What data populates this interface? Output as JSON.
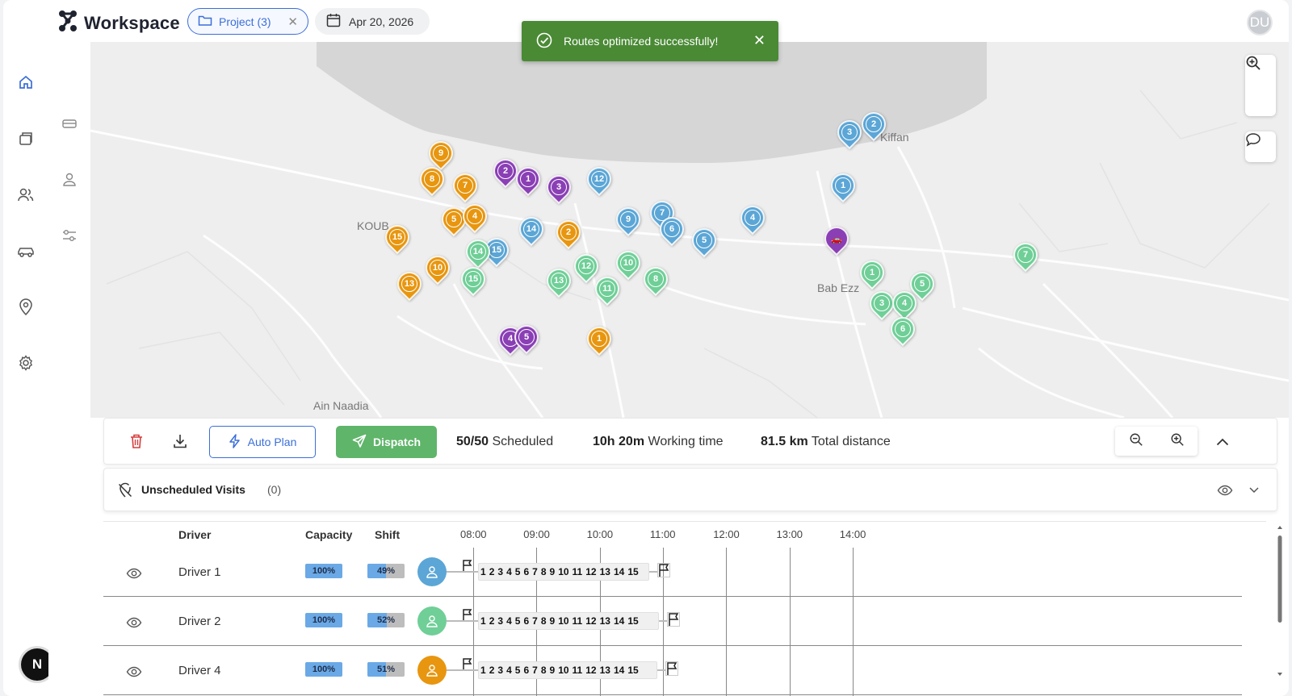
{
  "app": {
    "title": "Workspace",
    "avatar_initials": "DU",
    "n_badge": "N"
  },
  "chips": {
    "project_label": "Project (3)",
    "date_label": "Apr 20, 2026"
  },
  "toast": {
    "message": "Routes optimized successfully!"
  },
  "map": {
    "labels": {
      "kiffan": "Kiffan",
      "koub": "KOUB",
      "bab_ezz": "Bab Ezz",
      "ain_naadia": "Ain Naadia"
    },
    "colors": {
      "blue": "#5ba6d6",
      "orange": "#e8960f",
      "purple": "#8a3fb5",
      "green": "#6fcf97"
    },
    "pins": {
      "blue": [
        "3",
        "2",
        "12",
        "1",
        "4",
        "7",
        "9",
        "6",
        "5",
        "14",
        "15"
      ],
      "orange": [
        "9",
        "8",
        "7",
        "5",
        "4",
        "2",
        "15",
        "10",
        "13",
        "1"
      ],
      "purple": [
        "2",
        "1",
        "3",
        "4",
        "5"
      ],
      "green": [
        "14",
        "15",
        "13",
        "12",
        "11",
        "10",
        "8",
        "1",
        "7",
        "5",
        "3",
        "4",
        "6"
      ]
    }
  },
  "toolbar": {
    "auto_plan": "Auto Plan",
    "dispatch": "Dispatch",
    "scheduled_value": "50/50",
    "scheduled_label": "Scheduled",
    "working_value": "10h 20m",
    "working_label": "Working time",
    "distance_value": "81.5 km",
    "distance_label": "Total distance"
  },
  "unscheduled": {
    "label": "Unscheduled Visits",
    "count": "(0)"
  },
  "table": {
    "headers": {
      "driver": "Driver",
      "capacity": "Capacity",
      "shift": "Shift"
    },
    "times": [
      "08:00",
      "09:00",
      "10:00",
      "11:00",
      "12:00",
      "13:00",
      "14:00"
    ],
    "rows": [
      {
        "name": "Driver 1",
        "capacity": "100%",
        "shift": "49%",
        "shift_value": 0.49,
        "color": "#5ba6d6",
        "stops": [
          "1",
          "2",
          "3",
          "4",
          "5",
          "6",
          "7",
          "8",
          "9",
          "10",
          "11",
          "12",
          "13",
          "14",
          "15"
        ]
      },
      {
        "name": "Driver 2",
        "capacity": "100%",
        "shift": "52%",
        "shift_value": 0.52,
        "color": "#6fcf97",
        "stops": [
          "1",
          "2",
          "3",
          "4",
          "5",
          "6",
          "7",
          "8",
          "9",
          "10",
          "11",
          "12",
          "13",
          "14",
          "15"
        ]
      },
      {
        "name": "Driver 4",
        "capacity": "100%",
        "shift": "51%",
        "shift_value": 0.51,
        "color": "#e8960f",
        "stops": [
          "1",
          "2",
          "3",
          "4",
          "5",
          "6",
          "7",
          "8",
          "9",
          "10",
          "11",
          "12",
          "13",
          "14",
          "15"
        ]
      }
    ]
  }
}
